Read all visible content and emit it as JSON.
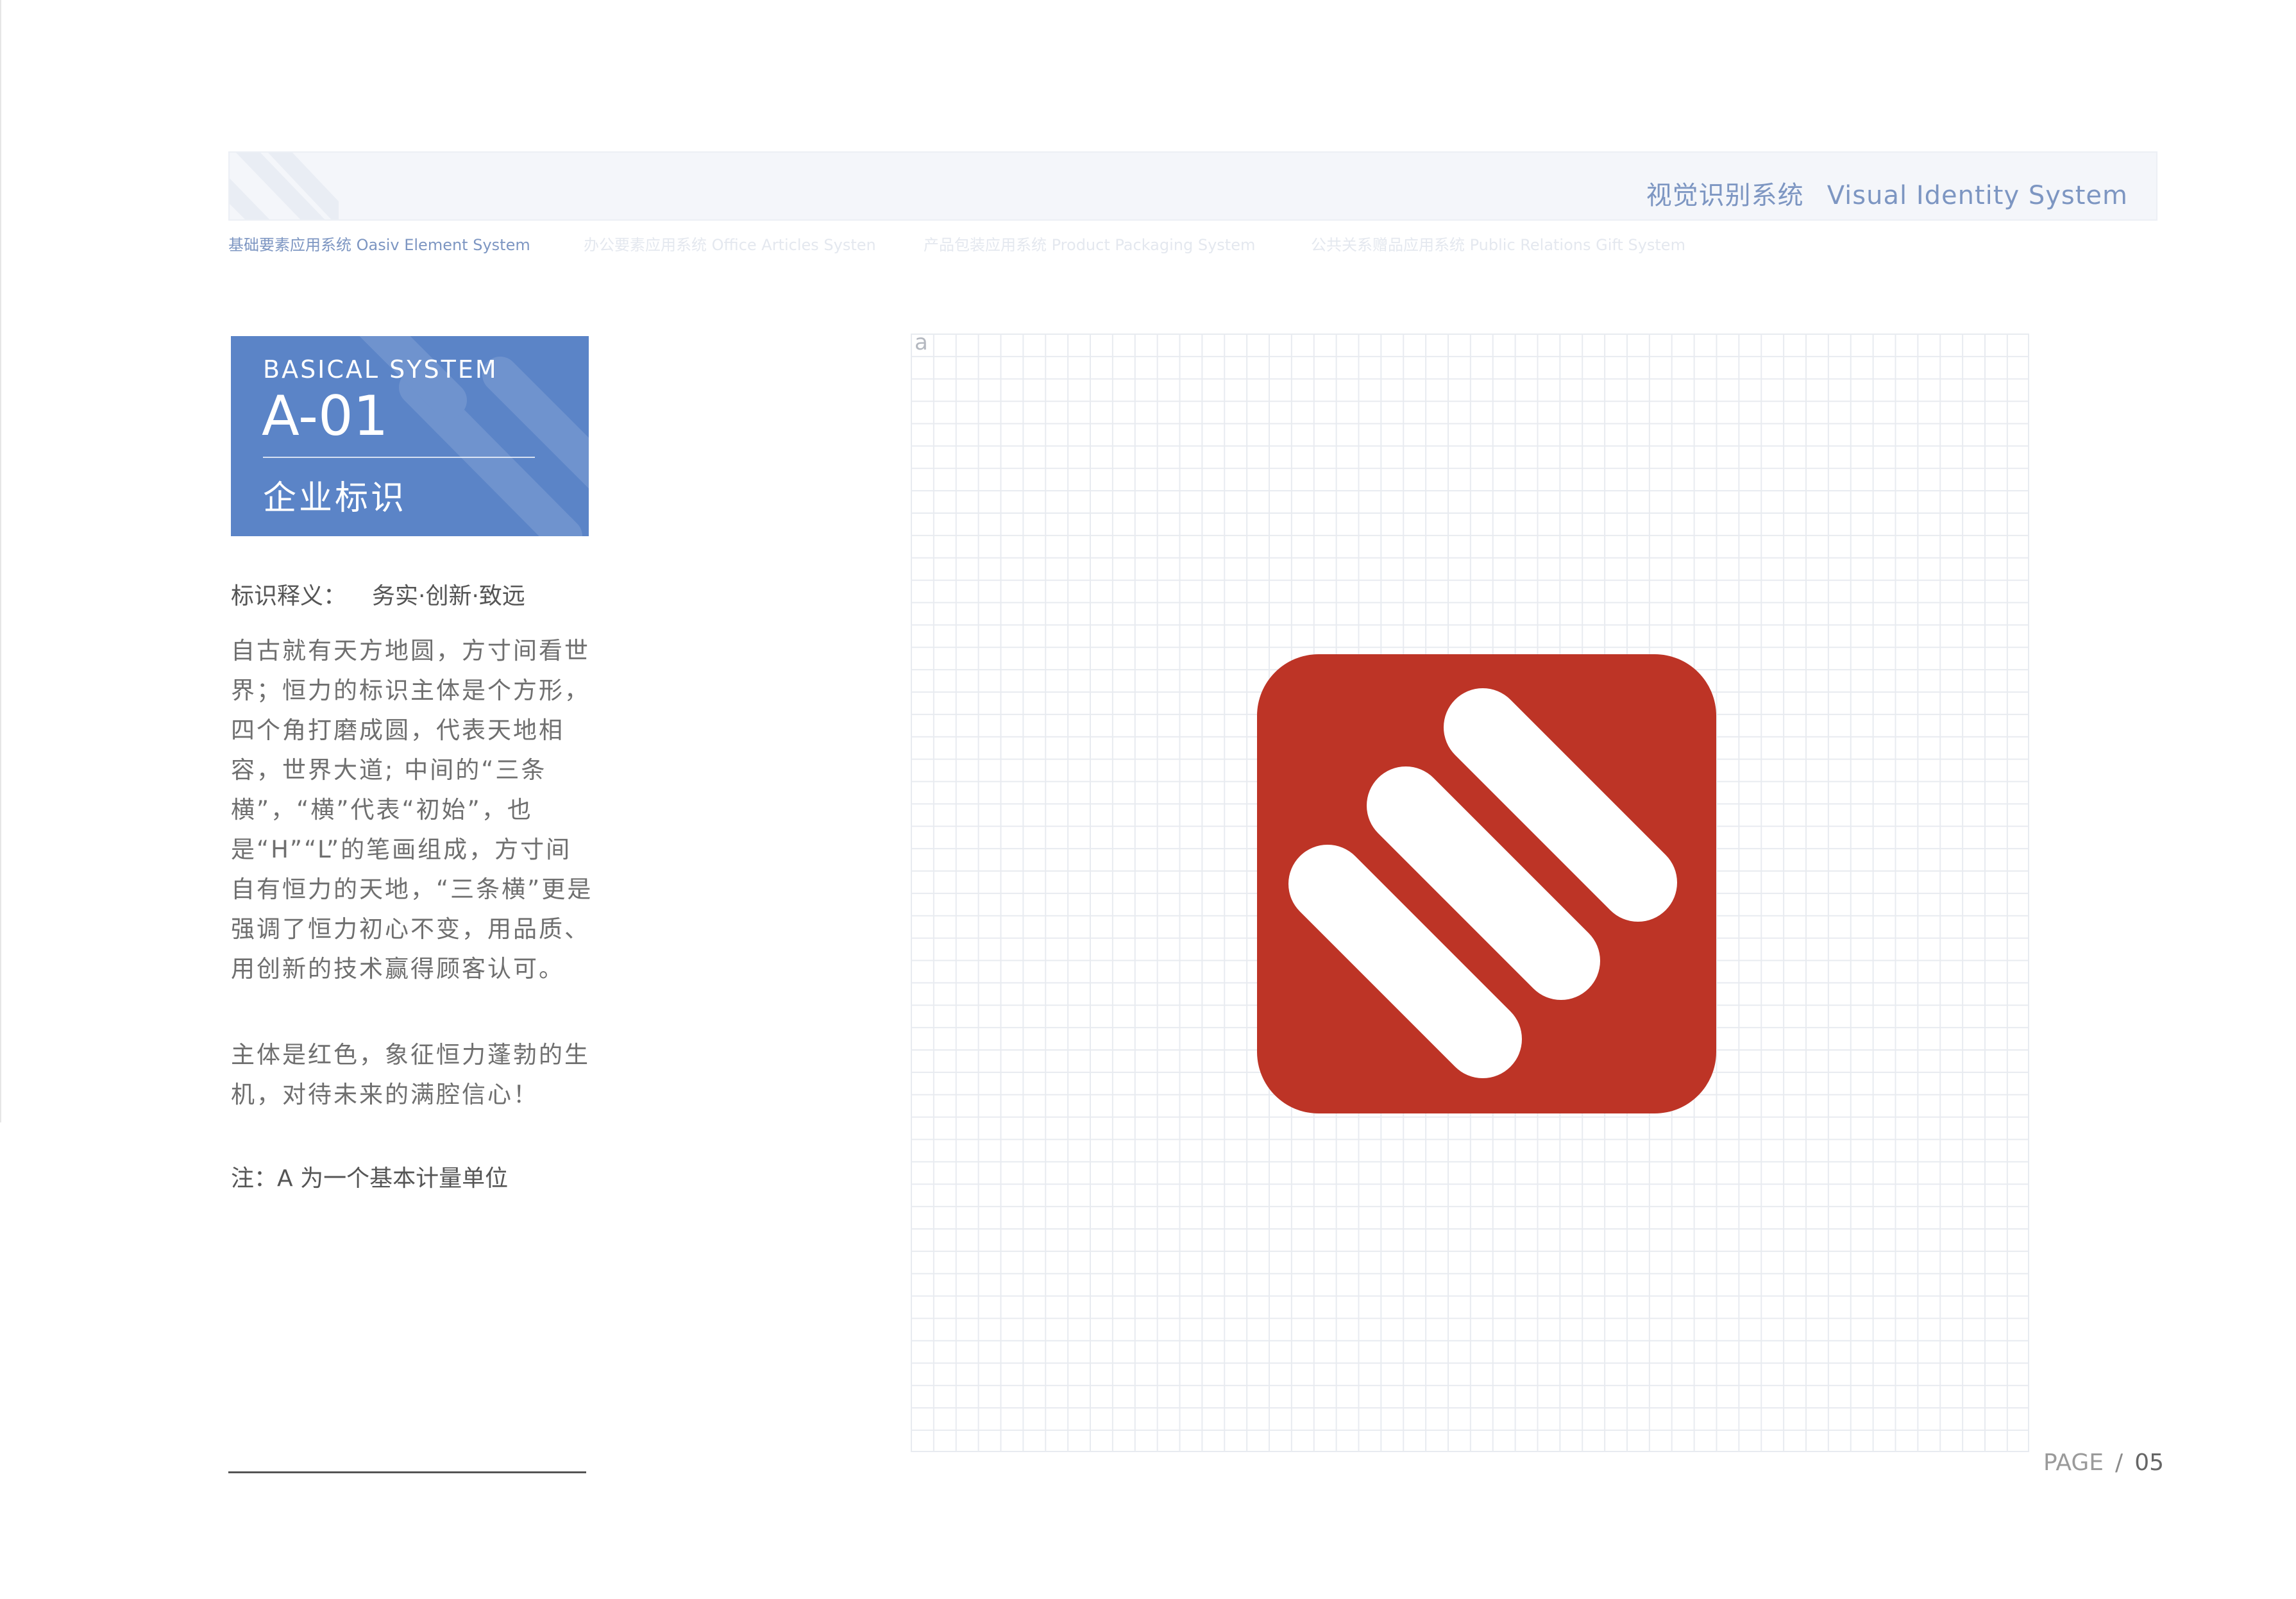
{
  "header": {
    "title_cn": "视觉识别系统",
    "title_en": "Visual Identity System"
  },
  "subnav": [
    {
      "label": "基础要素应用系统 Oasiv Element System",
      "active": true
    },
    {
      "label": "办公要素应用系统 Office Articles Systen",
      "active": false
    },
    {
      "label": "产品包装应用系统 Product Packaging System",
      "active": false
    },
    {
      "label": "公共关系赠品应用系统 Public Relations Gift System",
      "active": false
    }
  ],
  "card": {
    "kicker": "BASICAL SYSTEM",
    "code": "A-01",
    "title": "企业标识"
  },
  "meaning": {
    "label": "标识释义：",
    "value": "务实·创新·致远"
  },
  "paragraphs": [
    "自古就有天方地圆，方寸间看世界；恒力的标识主体是个方形，四个角打磨成圆，代表天地相容，世界大道; 中间的“三条横”，“横”代表“初始”，也是“H”“L”的笔画组成，方寸间自有恒力的天地，“三条横”更是强调了恒力初心不变，用品质、用创新的技术赢得顾客认可。",
    "主体是红色，象征恒力蓬勃的生机，对待未来的满腔信心！"
  ],
  "note": "注：A 为一个基本计量单位",
  "grid": {
    "unit_label": "a"
  },
  "logo": {
    "icon": "hengli-three-bars-logo",
    "bg_color": "#bd3426",
    "bar_color": "#ffffff"
  },
  "page": {
    "label": "PAGE",
    "separator": "/",
    "number": "05"
  },
  "colors": {
    "accent": "#5b84c7",
    "header_text": "#7d96c2"
  }
}
